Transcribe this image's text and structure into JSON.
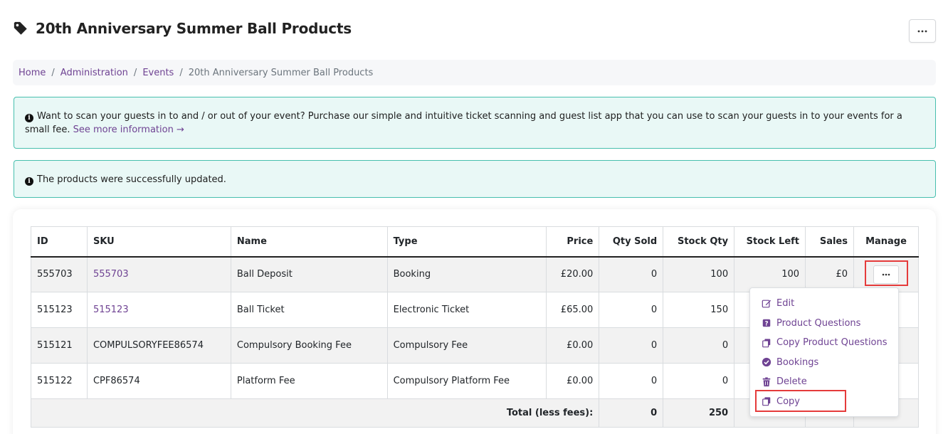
{
  "page": {
    "title": "20th Anniversary Summer Ball Products",
    "more_label": "···"
  },
  "breadcrumb": {
    "items": [
      "Home",
      "Administration",
      "Events"
    ],
    "current": "20th Anniversary Summer Ball Products",
    "separator": "/"
  },
  "alerts": {
    "scan_text": "Want to scan your guests in to and / or out of your event? Purchase our simple and intuitive ticket scanning and guest list app that you can use to scan your guests in to your events for a small fee.",
    "scan_link": "See more information →",
    "success_text": "The products were successfully updated."
  },
  "table": {
    "headers": [
      "ID",
      "SKU",
      "Name",
      "Type",
      "Price",
      "Qty Sold",
      "Stock Qty",
      "Stock Left",
      "Sales",
      "Manage"
    ],
    "rows": [
      {
        "id": "555703",
        "sku": "555703",
        "name": "Ball Deposit",
        "type": "Booking",
        "price": "£20.00",
        "qty_sold": "0",
        "stock_qty": "100",
        "stock_left": "100",
        "sales": "£0"
      },
      {
        "id": "515123",
        "sku": "515123",
        "name": "Ball Ticket",
        "type": "Electronic Ticket",
        "price": "£65.00",
        "qty_sold": "0",
        "stock_qty": "150",
        "stock_left": "",
        "sales": ""
      },
      {
        "id": "515121",
        "sku": "COMPULSORYFEE86574",
        "name": "Compulsory Booking Fee",
        "type": "Compulsory Fee",
        "price": "£0.00",
        "qty_sold": "0",
        "stock_qty": "0",
        "stock_left": "",
        "sales": ""
      },
      {
        "id": "515122",
        "sku": "CPF86574",
        "name": "Platform Fee",
        "type": "Compulsory Platform Fee",
        "price": "£0.00",
        "qty_sold": "0",
        "stock_qty": "0",
        "stock_left": "",
        "sales": ""
      }
    ],
    "total": {
      "label": "Total (less fees):",
      "qty_sold": "0",
      "stock_qty": "250"
    }
  },
  "dropdown": {
    "items": [
      {
        "label": "Edit",
        "icon": "edit-icon"
      },
      {
        "label": "Product Questions",
        "icon": "question-icon"
      },
      {
        "label": "Copy Product Questions",
        "icon": "copy-icon"
      },
      {
        "label": "Bookings",
        "icon": "check-circle-icon"
      },
      {
        "label": "Delete",
        "icon": "trash-icon"
      },
      {
        "label": "Copy",
        "icon": "copy-icon"
      }
    ]
  },
  "colors": {
    "accent": "#6f4393",
    "alert_border": "#47bfae",
    "alert_bg": "#e9f8f6",
    "highlight": "#e53b3b"
  }
}
